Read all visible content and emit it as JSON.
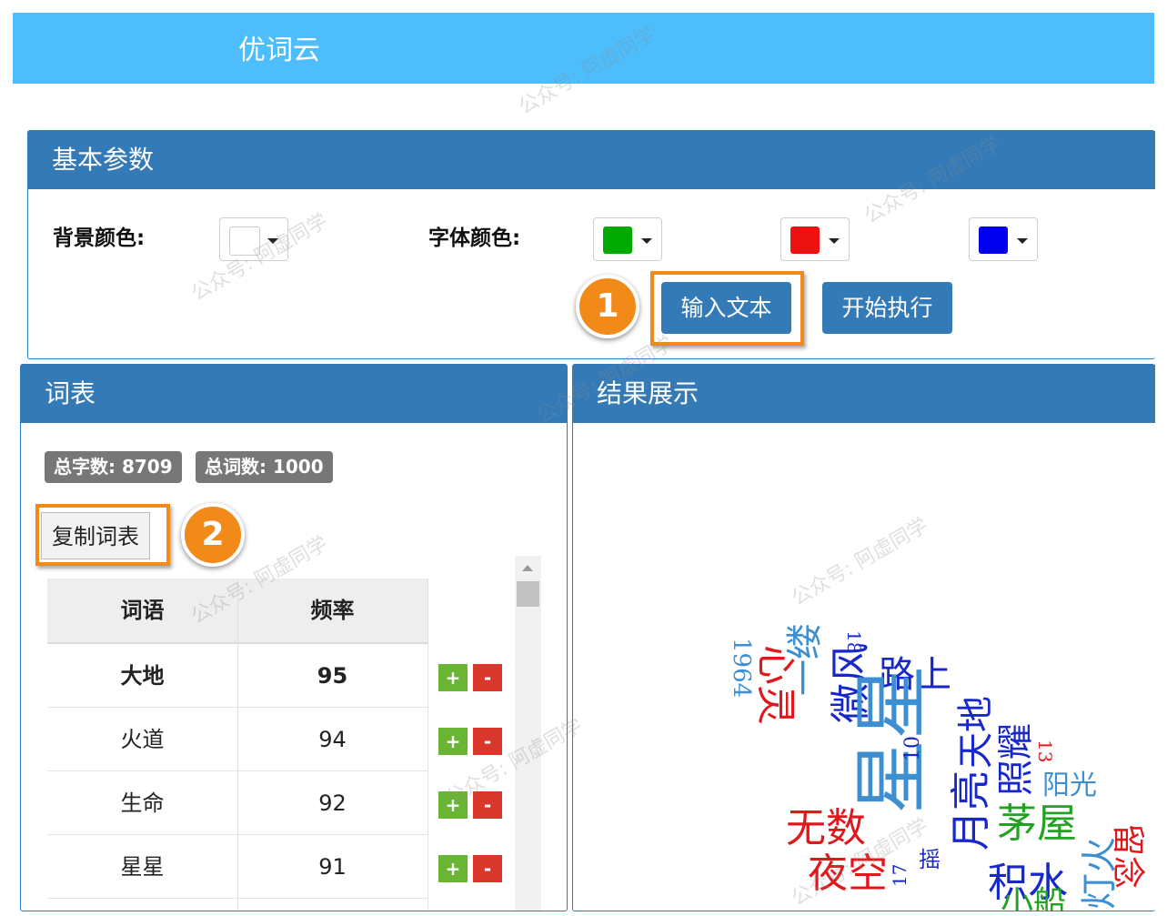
{
  "app": {
    "title": "优词云"
  },
  "params": {
    "header": "基本参数",
    "bg_label": "背景颜色:",
    "font_label": "字体颜色:",
    "bg_color": "#ffffff",
    "font_colors": [
      "#00aa00",
      "#ee1111",
      "#0000ee"
    ],
    "input_button": "输入文本",
    "run_button": "开始执行"
  },
  "annotations": {
    "step1": "1",
    "step2": "2"
  },
  "wordlist": {
    "header": "词表",
    "total_chars": "总字数: 8709",
    "total_words": "总词数: 1000",
    "copy_button": "复制词表",
    "columns": [
      "词语",
      "频率"
    ],
    "rows": [
      {
        "word": "大地",
        "freq": "95"
      },
      {
        "word": "火道",
        "freq": "94"
      },
      {
        "word": "生命",
        "freq": "92"
      },
      {
        "word": "星星",
        "freq": "91"
      }
    ],
    "plus": "+",
    "minus": "-"
  },
  "result": {
    "header": "结果展示",
    "cloud_words": [
      "1964",
      "心灵",
      "一缕",
      "18",
      "路上",
      "微风",
      "星星",
      "天地",
      "照耀",
      "阳光",
      "茅屋",
      "月亮",
      "积水",
      "无数",
      "夜空",
      "灯火",
      "留念",
      "10",
      "13",
      "17",
      "摇",
      "小船"
    ]
  },
  "watermark": "公众号: 阿虚同学"
}
